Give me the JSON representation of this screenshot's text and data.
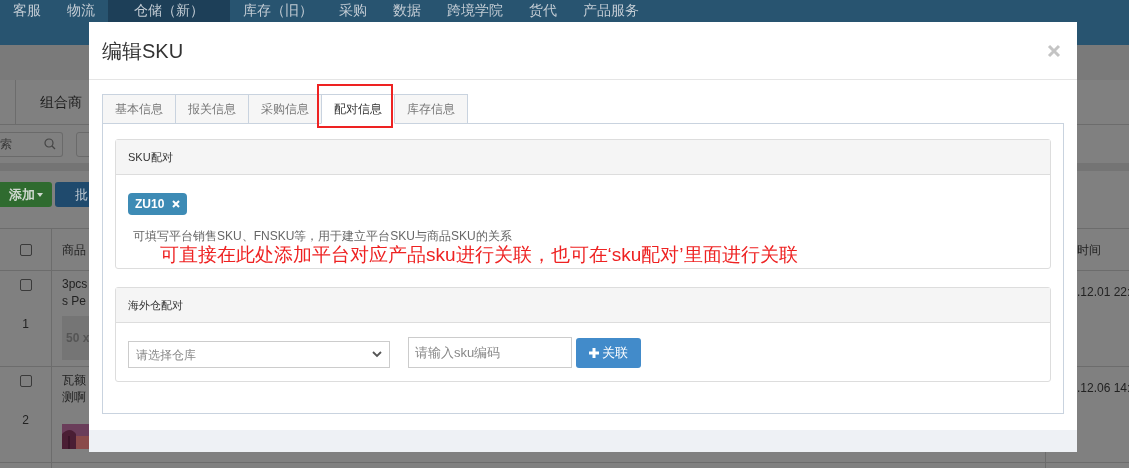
{
  "nav": [
    {
      "label": "客服",
      "selected": false
    },
    {
      "label": "物流",
      "selected": false
    },
    {
      "label": "仓储（新）",
      "selected": true
    },
    {
      "label": "库存（旧）",
      "selected": false
    },
    {
      "label": "采购",
      "selected": false
    },
    {
      "label": "数据",
      "selected": false
    },
    {
      "label": "跨境学院",
      "selected": false
    },
    {
      "label": "货代",
      "selected": false
    },
    {
      "label": "产品服务",
      "selected": false
    }
  ],
  "background": {
    "subtab": "组合商",
    "search_text": "索",
    "add_button": "添加",
    "batch_button": "批",
    "table": {
      "header": {
        "checked": false,
        "name": "商品",
        "time": "时间"
      },
      "rows": [
        {
          "checked": false,
          "index": "1",
          "name_lines": [
            "3pcs",
            "s Pe"
          ],
          "thumb_text": "50 x",
          "time": ".12.01 22:"
        },
        {
          "checked": false,
          "index": "2",
          "name_lines": [
            "瓦额",
            "测啊"
          ],
          "time": ".12.06 14:"
        }
      ]
    }
  },
  "modal": {
    "title": "编辑SKU",
    "tabs": [
      {
        "label": "基本信息",
        "selected": false,
        "annotated": false
      },
      {
        "label": "报关信息",
        "selected": false,
        "annotated": false
      },
      {
        "label": "采购信息",
        "selected": false,
        "annotated": false
      },
      {
        "label": "配对信息",
        "selected": true,
        "annotated": true
      },
      {
        "label": "库存信息",
        "selected": false,
        "annotated": false
      }
    ],
    "sku_panel": {
      "title": "SKU配对",
      "tags": [
        "ZU10"
      ],
      "help": "可填写平台销售SKU、FNSKU等，用于建立平台SKU与商品SKU的关系",
      "annotation": "可直接在此处添加平台对应产品sku进行关联，也可在‘sku配对’里面进行关联"
    },
    "warehouse_panel": {
      "title": "海外仓配对",
      "select_placeholder": "请选择仓库",
      "input_placeholder": "请输入sku编码",
      "button": "关联"
    }
  }
}
